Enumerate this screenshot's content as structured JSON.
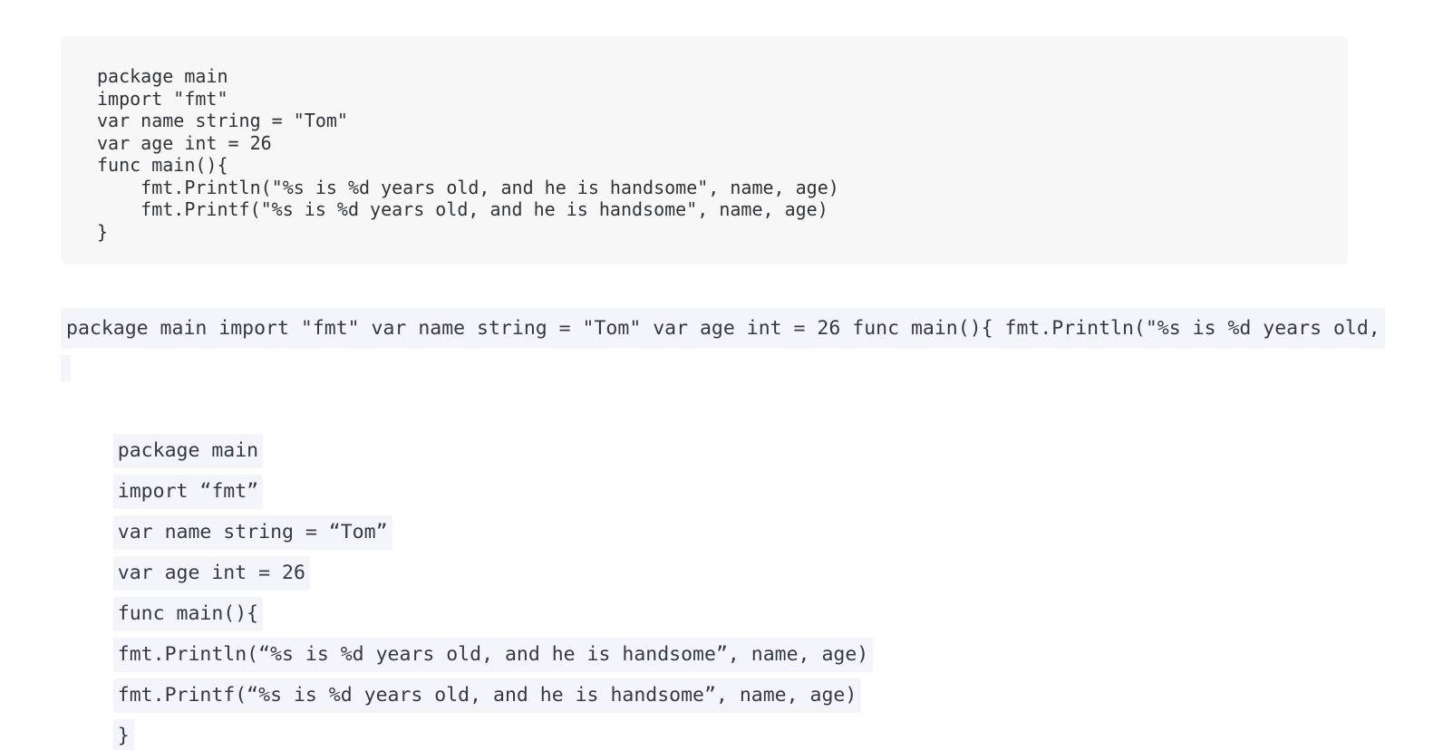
{
  "document": {
    "code_block": {
      "language": "go",
      "lines": [
        "package main",
        "import \"fmt\"",
        "var name string = \"Tom\"",
        "var age int = 26",
        "func main(){",
        "    fmt.Println(\"%s is %d years old, and he is handsome\", name, age)",
        "    fmt.Printf(\"%s is %d years old, and he is handsome\", name, age)",
        "}"
      ],
      "text": "package main\nimport \"fmt\"\nvar name string = \"Tom\"\nvar age int = 26\nfunc main(){\n    fmt.Println(\"%s is %d years old, and he is handsome\", name, age)\n    fmt.Printf(\"%s is %d years old, and he is handsome\", name, age)\n}"
    },
    "overflow_line": {
      "text": "package main import \"fmt\" var name string = \"Tom\" var age int = 26 func main(){ fmt.Println(\"%s is %d years old, and he is handsome\", name, age) fmt.Printf(\"%s is %d years old, and he is handsome\", name, age) }",
      "clipped": true,
      "visible_text": "package main import \"fmt\" var name string = \"Tom\" var age int = 26 func main(){ fmt.Println(\"%"
    },
    "blank_line": {
      "text": ""
    },
    "wrapped_lines": [
      {
        "text": "package main"
      },
      {
        "text": "import “fmt”"
      },
      {
        "text": "var name string = “Tom”"
      },
      {
        "text": "var age int = 26"
      },
      {
        "text": "func main(){"
      },
      {
        "text": "fmt.Println(“%s is %d years old, and he is handsome”, name, age)"
      },
      {
        "text": "fmt.Printf(“%s is %d years old, and he is handsome”, name, age)"
      },
      {
        "text": "}"
      }
    ]
  },
  "colors": {
    "page_background": "#ffffff",
    "code_block_background": "#f7f7f8",
    "inline_highlight_background": "#f4f5fa",
    "code_text": "#2f3338",
    "highlight_text": "#333a42"
  }
}
